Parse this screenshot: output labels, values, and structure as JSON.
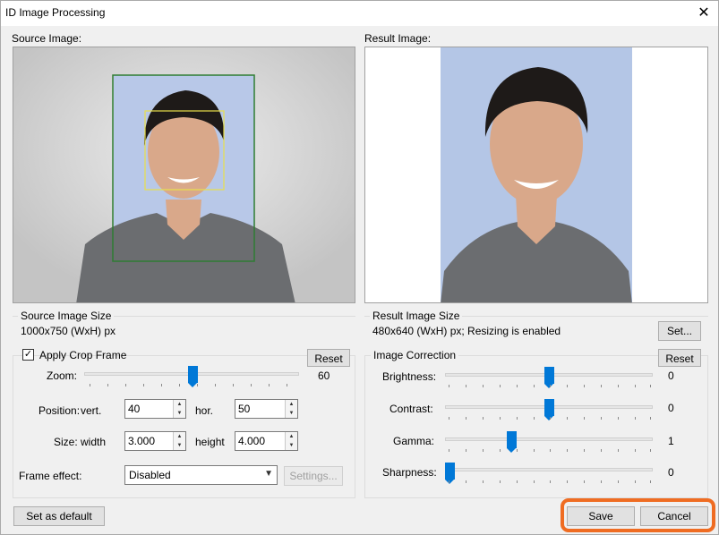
{
  "window": {
    "title": "ID Image Processing",
    "close_glyph": "✕"
  },
  "source": {
    "label": "Source Image:"
  },
  "result": {
    "label": "Result Image:"
  },
  "source_size": {
    "legend": "Source Image Size",
    "value": "1000x750 (WxH) px"
  },
  "result_size": {
    "legend": "Result Image Size",
    "value": "480x640 (WxH) px; Resizing is enabled",
    "set_label": "Set..."
  },
  "crop": {
    "checkbox_label": "Apply Crop Frame",
    "checked": true,
    "check_glyph": "✓",
    "reset_label": "Reset",
    "zoom_label": "Zoom:",
    "zoom_value": "60",
    "position_label": "Position:",
    "vert_label": "vert.",
    "vert_value": "40",
    "hor_label": "hor.",
    "hor_value": "50",
    "size_label": "Size:",
    "width_label": "width",
    "width_value": "3.000",
    "height_label": "height",
    "height_value": "4.000",
    "effect_label": "Frame effect:",
    "effect_value": "Disabled",
    "settings_label": "Settings..."
  },
  "correction": {
    "legend": "Image Correction",
    "reset_label": "Reset",
    "brightness_label": "Brightness:",
    "brightness_value": "0",
    "contrast_label": "Contrast:",
    "contrast_value": "0",
    "gamma_label": "Gamma:",
    "gamma_value": "1",
    "sharpness_label": "Sharpness:",
    "sharpness_value": "0"
  },
  "footer": {
    "default_label": "Set as default",
    "save_label": "Save",
    "cancel_label": "Cancel"
  },
  "colors": {
    "accent": "#0078d7",
    "highlight": "#ef6c22",
    "crop_frame": "#2e7d32",
    "face_frame": "#e8e04a",
    "photo_bg": "#b8c8e8"
  },
  "icons": {
    "close": "close-icon",
    "spin_up": "spin-up-icon",
    "spin_down": "spin-down-icon",
    "dropdown": "chevron-down-icon"
  }
}
